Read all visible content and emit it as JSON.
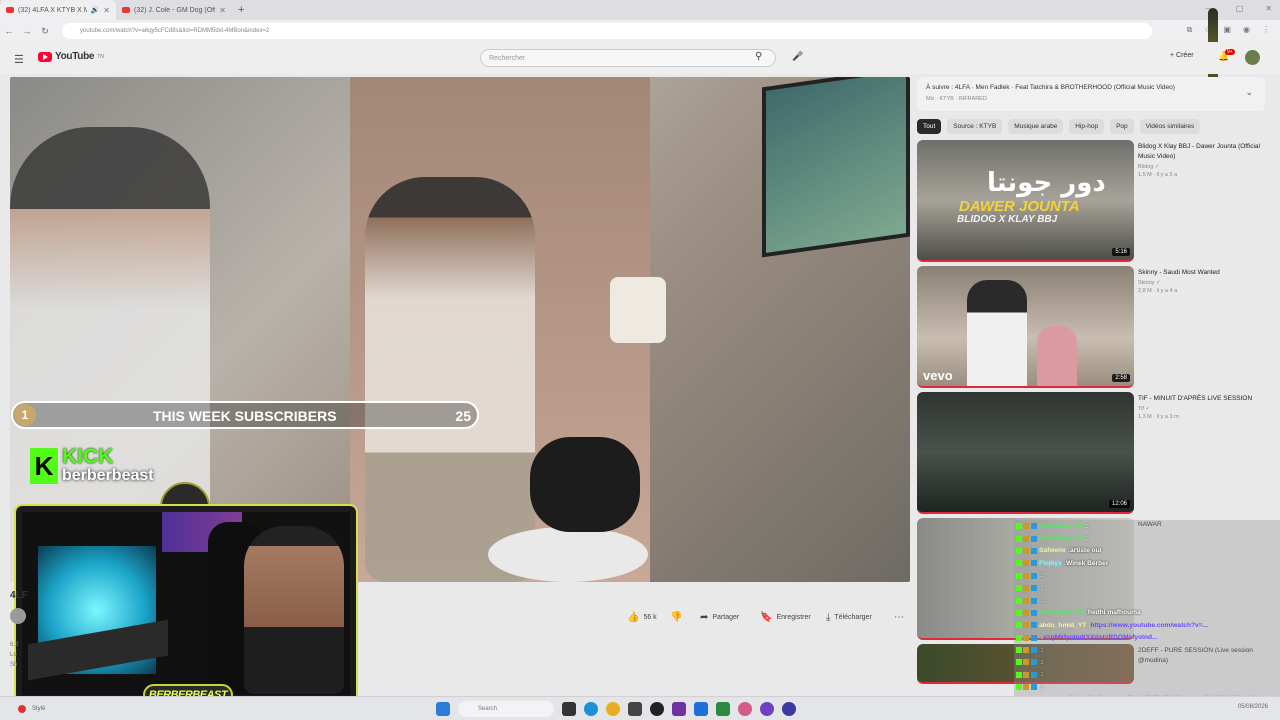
{
  "browser": {
    "tabs": [
      {
        "title": "(32) 4LFA X KTYB X Manol",
        "active": true
      },
      {
        "title": "(32) J. Cole - GM Dog (Officia",
        "active": false
      }
    ],
    "url": "youtube.com/watch?v=a6qy5cFCd8s&list=RDMM5dxl-4MBon&index=2"
  },
  "youtube": {
    "logo_text": "YouTube",
    "logo_country": "TN",
    "search_placeholder": "Rechercher",
    "create_label": "Créer",
    "notif_count": "9+"
  },
  "player": {
    "subs_rank": "1",
    "subs_label": "THIS WEEK SUBSCRIBERS",
    "subs_count": "25",
    "kick_brand": "KICK",
    "kick_user": "berberbeast",
    "cam_tag": "BERBERBEAST"
  },
  "below": {
    "title": "4LF",
    "like_count": "56 k",
    "share_label": "Partager",
    "save_label": "Enregistrer",
    "download_label": "Télécharger",
    "misc_lines": [
      "6.3",
      "Lo",
      "Sh"
    ]
  },
  "sidebar": {
    "upnext_title": "À suivre : 4LFA · Men Fadlek · Feat Tatchira & BROTHERHOOD (Official Music Video)",
    "upnext_sub": "Mix · KTYB · INFRARED",
    "chips": [
      "Tout",
      "Source : KTYB",
      "Musique arabe",
      "Hip-hop",
      "Pop",
      "Vidéos similaires"
    ],
    "videos": [
      {
        "title": "Blidog X Klay BBJ - Dawer Jounta (Official Music Video)",
        "channel": "Blidog ✓",
        "meta": "1,5 M · il y a 5 a",
        "duration": "5:16",
        "ar": "دور جونتا",
        "big": "DAWER JOUNTA",
        "sub": "BLIDOG X KLAY BBJ"
      },
      {
        "title": "Skinny - Saudi Most Wanted",
        "channel": "Skinny ✓",
        "meta": "2,8 M · il y a 4 a",
        "duration": "2:58",
        "badge": "vevo"
      },
      {
        "title": "TIF - MINUIT D'APRÈS LIVE SESSION",
        "channel": "Tif ✓",
        "meta": "1,3 M · il y a 3 m",
        "duration": "12:06"
      },
      {
        "title": "NAWAR",
        "channel": "",
        "meta": "",
        "duration": ""
      },
      {
        "title": "2DEFF - PURE SESSION (Live session @modina)",
        "channel": "",
        "meta": "",
        "duration": ""
      }
    ]
  },
  "chat": [
    {
      "user": "Kamouneya89",
      "text": "",
      "color": "#56e860"
    },
    {
      "user": "Kamouneya89",
      "text": "",
      "color": "#56e860"
    },
    {
      "user": "Safwenx",
      "text": "artiste oui",
      "color": "#f3f3a0"
    },
    {
      "user": "Flojkys",
      "text": "Winek Berber",
      "color": "#7ff"
    },
    {
      "user": "",
      "text": "",
      "color": "#e43"
    },
    {
      "user": "",
      "text": "",
      "color": "#e43"
    },
    {
      "user": "",
      "text": "",
      "color": "#e43"
    },
    {
      "user": "Kamouneya89",
      "text": "hedhi mafhouma",
      "color": "#56e860"
    },
    {
      "user": "abdo_hmid_YT",
      "text": "https://www.youtube.com/watch?v=...",
      "color": "#f3f3a0",
      "link": true
    },
    {
      "user": "",
      "text": "v=gMkfyolndtY&list=RDGMsfyolnd...",
      "color": "#f3f3a0",
      "link": true
    },
    {
      "user": "",
      "text": "",
      "color": "#e43"
    },
    {
      "user": "",
      "text": "",
      "color": "#e43"
    },
    {
      "user": "",
      "text": "",
      "color": "#e43"
    },
    {
      "user": "",
      "text": "",
      "color": "#e43"
    },
    {
      "user": "Safwenx",
      "text": "benesba liye ena album ili fih Kimbenpe w Jrad khir bbarcha",
      "color": "#f3f3a0"
    }
  ],
  "taskbar": {
    "weather": "Stylé",
    "search": "Search",
    "time": "05/08/2026"
  }
}
